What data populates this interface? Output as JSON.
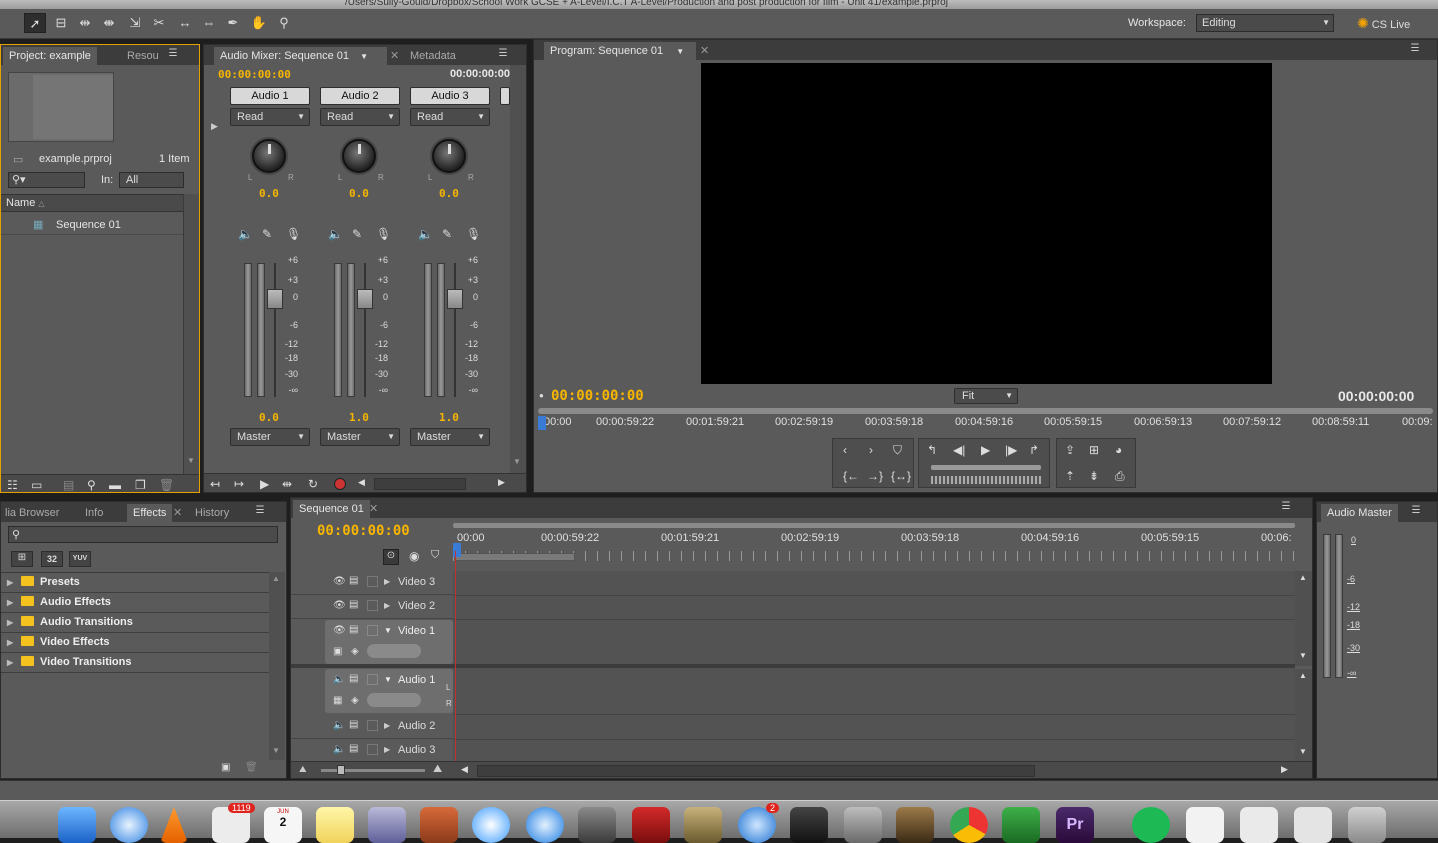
{
  "window": {
    "title": "/Users/Sully-Gould/Dropbox/School Work GCSE + A-Level/I.C.T A-Level/Production and post production for film - Unit 41/example.prproj"
  },
  "workspace": {
    "label": "Workspace:",
    "value": "Editing",
    "cslive": "CS Live"
  },
  "project": {
    "tabs": [
      "Project: example",
      "Resou"
    ],
    "filename": "example.prproj",
    "count": "1 Item",
    "in_label": "In:",
    "in_value": "All",
    "column_name": "Name",
    "items": [
      "Sequence 01"
    ]
  },
  "mixer": {
    "tabs": [
      "Audio Mixer: Sequence 01",
      "Metadata"
    ],
    "timecode_left": "00:00:00:00",
    "timecode_right": "00:00:00:00",
    "channels": [
      {
        "name": "Audio 1",
        "mode": "Read",
        "pan": "0.0",
        "volume": "0.0",
        "output": "Master"
      },
      {
        "name": "Audio 2",
        "mode": "Read",
        "pan": "0.0",
        "volume": "1.0",
        "output": "Master"
      },
      {
        "name": "Audio 3",
        "mode": "Read",
        "pan": "0.0",
        "volume": "1.0",
        "output": "Master"
      }
    ],
    "db_scale": [
      "+6",
      "+3",
      "0",
      "-6",
      "-12",
      "-18",
      "-30",
      "-∞"
    ]
  },
  "program": {
    "tab": "Program: Sequence 01",
    "timecode_left": "00:00:00:00",
    "timecode_right": "00:00:00:00",
    "fit": "Fit",
    "ruler": [
      "00:00",
      "00:00:59:22",
      "00:01:59:21",
      "00:02:59:19",
      "00:03:59:18",
      "00:04:59:16",
      "00:05:59:15",
      "00:06:59:13",
      "00:07:59:12",
      "00:08:59:11",
      "00:09:"
    ]
  },
  "effects": {
    "tabs": [
      "lia Browser",
      "Info",
      "Effects",
      "History"
    ],
    "badges": [
      "32",
      "YUV"
    ],
    "items": [
      "Presets",
      "Audio Effects",
      "Audio Transitions",
      "Video Effects",
      "Video Transitions"
    ]
  },
  "sequence": {
    "tab": "Sequence 01",
    "timecode": "00:00:00:00",
    "ruler": [
      "00:00",
      "00:00:59:22",
      "00:01:59:21",
      "00:02:59:19",
      "00:03:59:18",
      "00:04:59:16",
      "00:05:59:15",
      "00:06:"
    ],
    "tracks": [
      "Video 3",
      "Video 2",
      "Video 1",
      "Audio 1",
      "Audio 2",
      "Audio 3"
    ],
    "channel_letters": [
      "L",
      "R"
    ]
  },
  "audio_master": {
    "tab": "Audio Master",
    "scale": [
      "0",
      "-6",
      "-12",
      "-18",
      "-30",
      "-∞"
    ]
  },
  "dock": {
    "badges": [
      "1119",
      "2"
    ],
    "calendar_month": "JUN",
    "calendar_day": "2"
  }
}
